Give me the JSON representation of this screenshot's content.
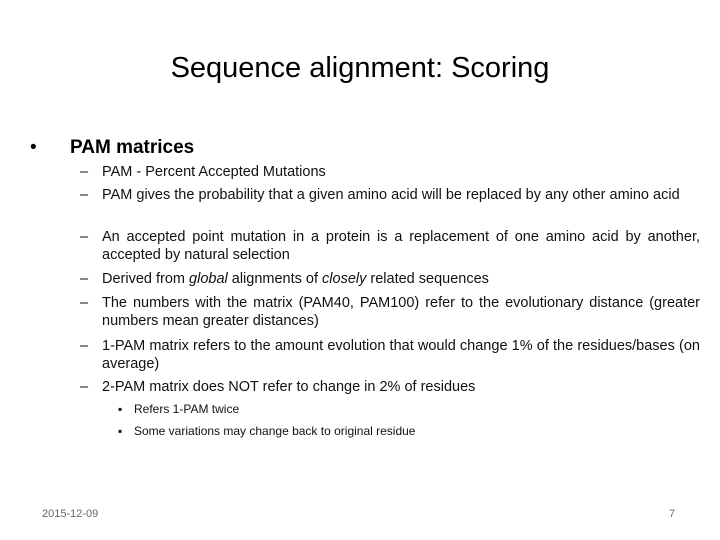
{
  "slide": {
    "title": "Sequence alignment: Scoring",
    "bullet": "•",
    "heading": "PAM matrices",
    "dash": "–",
    "sub_bullet": "▪",
    "points": [
      {
        "text": "PAM - Percent Accepted Mutations"
      },
      {
        "text": "PAM gives the probability that a given amino acid will be replaced by any other amino acid"
      },
      {
        "text": "An accepted point mutation in a protein is a replacement of one amino acid by another, accepted by natural selection"
      },
      {
        "pre": "Derived from ",
        "em1": "global",
        "mid": " alignments of ",
        "em2": "closely",
        "post": " related sequences"
      },
      {
        "text": "The numbers with the matrix (PAM40, PAM100) refer to the evolutionary distance (greater numbers mean greater distances)"
      },
      {
        "text": "1-PAM matrix refers to the amount evolution that would change  1% of the residues/bases (on average)"
      },
      {
        "text": "2-PAM matrix does NOT refer to change in 2% of residues"
      }
    ],
    "subpoints": [
      "Refers 1-PAM twice",
      "Some variations may change back to original residue"
    ]
  },
  "footer": {
    "date": "2015-12-09",
    "page_number": "7"
  }
}
